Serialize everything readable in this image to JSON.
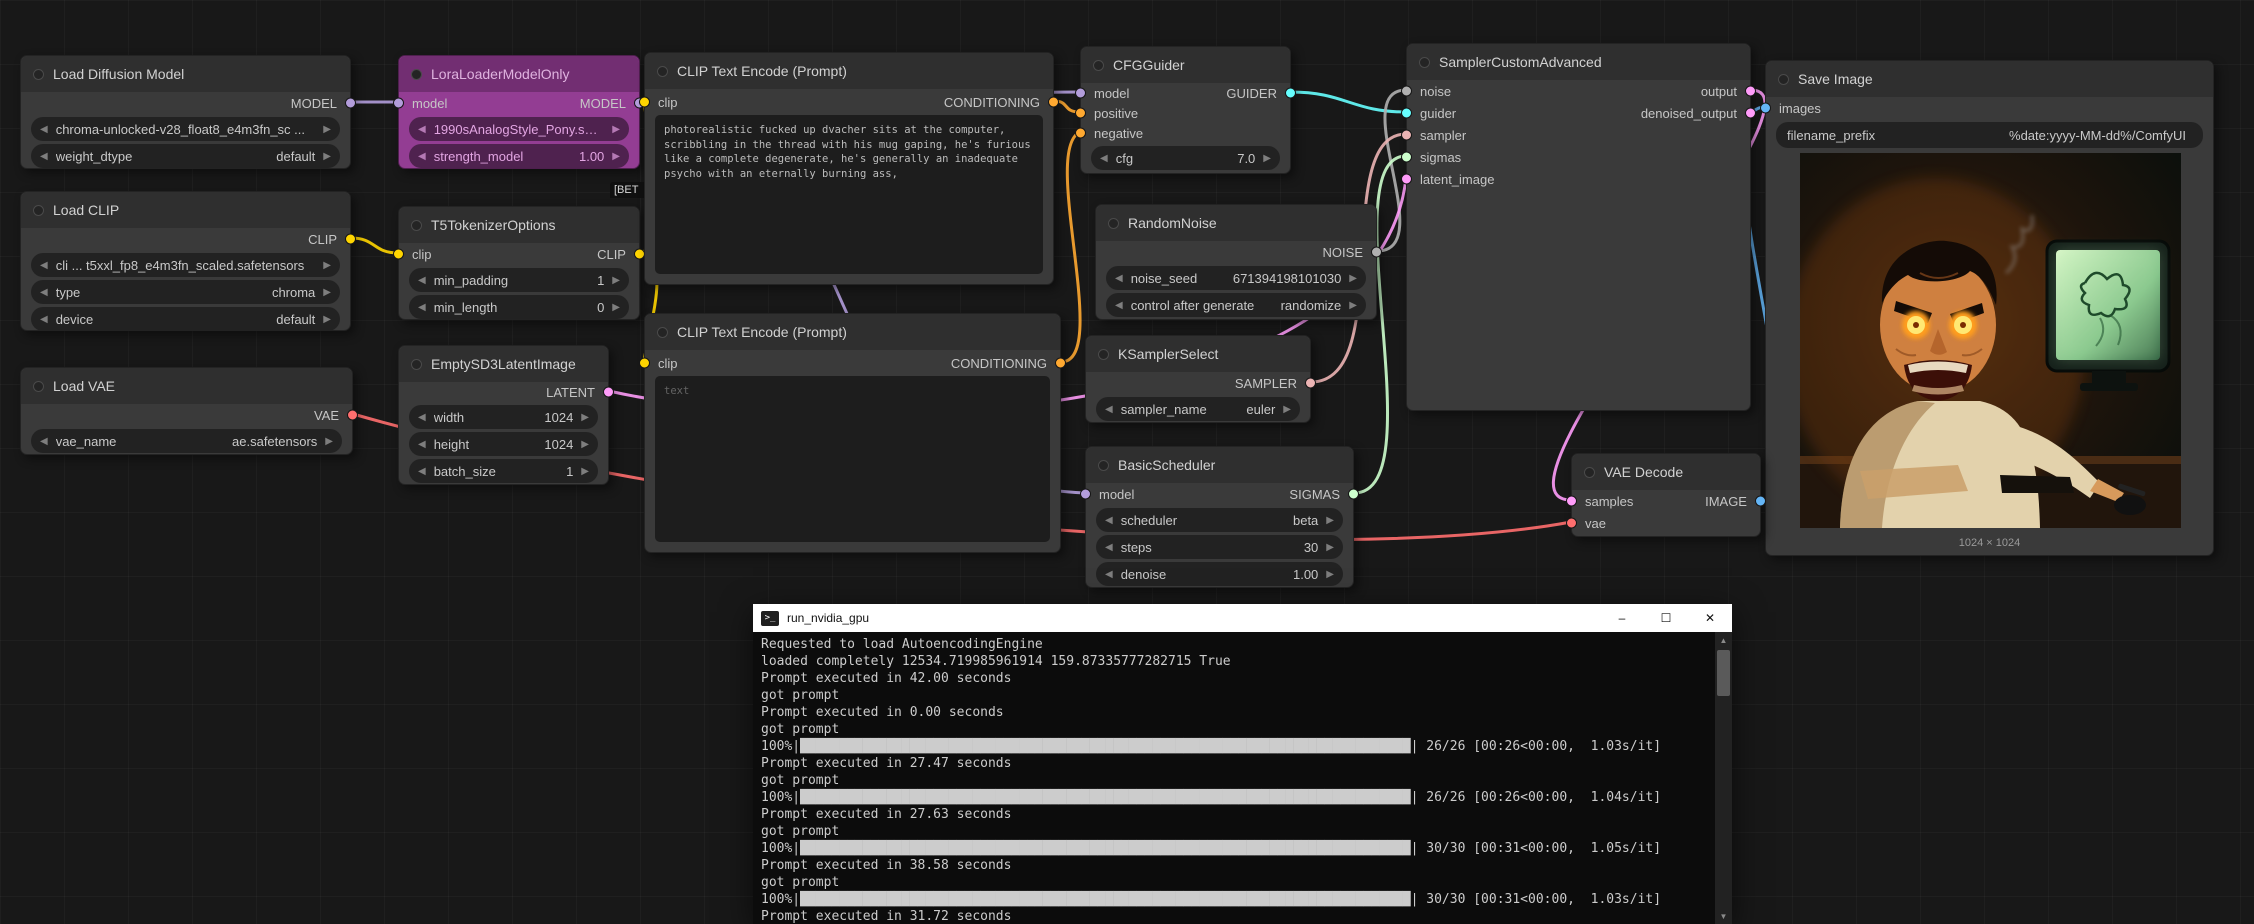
{
  "colors": {
    "model": "#B39DDB",
    "clip": "#FFD500",
    "vae": "#FF6E6E",
    "conditioning": "#FFA931",
    "latent": "#FF9CF9",
    "image": "#64B5F6",
    "guider": "#66FFFF",
    "sampler": "#ECB4B4",
    "sigmas": "#CDFFCD",
    "noise": "#B0B0B0"
  },
  "icons": {
    "combo_left": "◀",
    "combo_right": "▶",
    "scroll_up": "▲",
    "scroll_down": "▼",
    "console": ">_"
  },
  "nodes": {
    "ldm": {
      "title": "Load Diffusion Model",
      "outputs": [
        {
          "name": "MODEL"
        }
      ],
      "widgets": [
        {
          "value": "chroma-unlocked-v28_float8_e4m3fn_sc ..."
        },
        {
          "label": "weight_dtype",
          "value": "default"
        }
      ]
    },
    "lora": {
      "title": "LoraLoaderModelOnly",
      "inputs": [
        {
          "name": "model"
        }
      ],
      "outputs": [
        {
          "name": "MODEL"
        }
      ],
      "widgets": [
        {
          "value": "1990sAnalogStyle_Pony.safe..."
        },
        {
          "label": "strength_model",
          "value": "1.00"
        }
      ]
    },
    "tag": {
      "label": "[BET"
    },
    "clip1": {
      "title": "CLIP Text Encode (Prompt)",
      "inputs": [
        {
          "name": "clip"
        }
      ],
      "outputs": [
        {
          "name": "CONDITIONING"
        }
      ],
      "text": "photorealistic fucked up dvacher sits at the computer, scribbling in the thread with his mug gaping, he's furious like a complete degenerate, he's generally an inadequate psycho with an eternally burning ass,"
    },
    "clip2": {
      "title": "CLIP Text Encode (Prompt)",
      "inputs": [
        {
          "name": "clip"
        }
      ],
      "outputs": [
        {
          "name": "CONDITIONING"
        }
      ],
      "placeholder": "text"
    },
    "cfg": {
      "title": "CFGGuider",
      "inputs": [
        {
          "name": "model"
        },
        {
          "name": "positive"
        },
        {
          "name": "negative"
        }
      ],
      "outputs": [
        {
          "name": "GUIDER"
        }
      ],
      "widgets": [
        {
          "label": "cfg",
          "value": "7.0"
        }
      ]
    },
    "sca": {
      "title": "SamplerCustomAdvanced",
      "inputs": [
        {
          "name": "noise"
        },
        {
          "name": "guider"
        },
        {
          "name": "sampler"
        },
        {
          "name": "sigmas"
        },
        {
          "name": "latent_image"
        }
      ],
      "outputs": [
        {
          "name": "output"
        },
        {
          "name": "denoised_output"
        }
      ]
    },
    "save": {
      "title": "Save Image",
      "inputs": [
        {
          "name": "images"
        }
      ],
      "widgets": [
        {
          "label": "filename_prefix",
          "value": "%date:yyyy-MM-dd%/ComfyUI"
        }
      ],
      "caption": "1024 × 1024"
    },
    "loadclip": {
      "title": "Load CLIP",
      "outputs": [
        {
          "name": "CLIP"
        }
      ],
      "widgets": [
        {
          "value": "cli ... t5xxl_fp8_e4m3fn_scaled.safetensors"
        },
        {
          "label": "type",
          "value": "chroma"
        },
        {
          "label": "device",
          "value": "default"
        }
      ]
    },
    "t5": {
      "title": "T5TokenizerOptions",
      "inputs": [
        {
          "name": "clip"
        }
      ],
      "outputs": [
        {
          "name": "CLIP"
        }
      ],
      "widgets": [
        {
          "label": "min_padding",
          "value": "1"
        },
        {
          "label": "min_length",
          "value": "0"
        }
      ]
    },
    "noise": {
      "title": "RandomNoise",
      "outputs": [
        {
          "name": "NOISE"
        }
      ],
      "widgets": [
        {
          "label": "noise_seed",
          "value": "671394198101030"
        },
        {
          "label": "control after generate",
          "value": "randomize"
        }
      ]
    },
    "ksel": {
      "title": "KSamplerSelect",
      "outputs": [
        {
          "name": "SAMPLER"
        }
      ],
      "widgets": [
        {
          "label": "sampler_name",
          "value": "euler"
        }
      ]
    },
    "vae": {
      "title": "Load VAE",
      "outputs": [
        {
          "name": "VAE"
        }
      ],
      "widgets": [
        {
          "label": "vae_name",
          "value": "ae.safetensors"
        }
      ]
    },
    "latent": {
      "title": "EmptySD3LatentImage",
      "outputs": [
        {
          "name": "LATENT"
        }
      ],
      "widgets": [
        {
          "label": "width",
          "value": "1024"
        },
        {
          "label": "height",
          "value": "1024"
        },
        {
          "label": "batch_size",
          "value": "1"
        }
      ]
    },
    "sched": {
      "title": "BasicScheduler",
      "inputs": [
        {
          "name": "model"
        }
      ],
      "outputs": [
        {
          "name": "SIGMAS"
        }
      ],
      "widgets": [
        {
          "label": "scheduler",
          "value": "beta"
        },
        {
          "label": "steps",
          "value": "30"
        },
        {
          "label": "denoise",
          "value": "1.00"
        }
      ]
    },
    "decode": {
      "title": "VAE Decode",
      "inputs": [
        {
          "name": "samples"
        },
        {
          "name": "vae"
        }
      ],
      "outputs": [
        {
          "name": "IMAGE"
        }
      ]
    }
  },
  "terminal": {
    "title": "run_nvidia_gpu",
    "controls": {
      "minimize": "–",
      "maximize": "☐",
      "close": "✕"
    },
    "lines": [
      {
        "text": "Requested to load AutoencodingEngine"
      },
      {
        "text": "loaded completely 12534.719985961914 159.87335777282715 True"
      },
      {
        "text": "Prompt executed in 42.00 seconds"
      },
      {
        "text": "got prompt"
      },
      {
        "text": "Prompt executed in 0.00 seconds"
      },
      {
        "text": "got prompt"
      },
      {
        "progress": true,
        "prefix": "100%|",
        "blocks": 78,
        "suffix": "| 26/26 [00:26<00:00,  1.03s/it]"
      },
      {
        "text": "Prompt executed in 27.47 seconds"
      },
      {
        "text": "got prompt"
      },
      {
        "progress": true,
        "prefix": "100%|",
        "blocks": 78,
        "suffix": "| 26/26 [00:26<00:00,  1.04s/it]"
      },
      {
        "text": "Prompt executed in 27.63 seconds"
      },
      {
        "text": "got prompt"
      },
      {
        "progress": true,
        "prefix": "100%|",
        "blocks": 78,
        "suffix": "| 30/30 [00:31<00:00,  1.05s/it]"
      },
      {
        "text": "Prompt executed in 38.58 seconds"
      },
      {
        "text": "got prompt"
      },
      {
        "progress": true,
        "prefix": "100%|",
        "blocks": 78,
        "suffix": "| 30/30 [00:31<00:00,  1.03s/it]"
      },
      {
        "text": "Prompt executed in 31.72 seconds"
      }
    ]
  }
}
